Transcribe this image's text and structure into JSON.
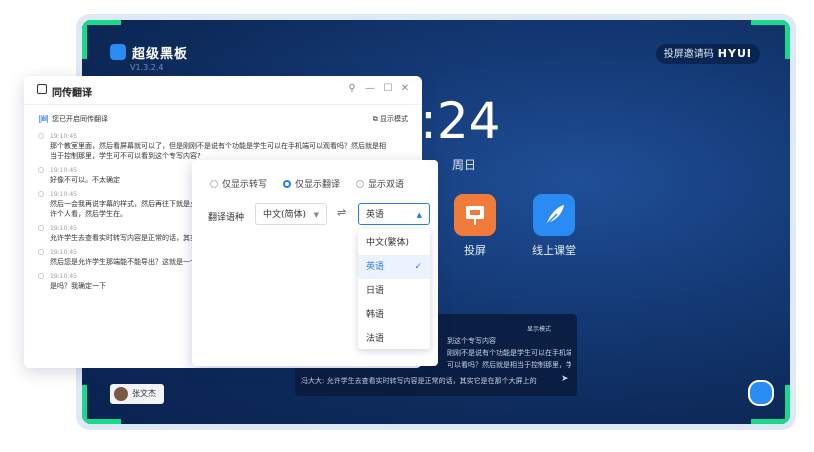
{
  "board": {
    "app_name": "超级黑板",
    "version": "V1.3.2.4",
    "code_label": "投屏邀请码",
    "code": "HYUI",
    "clock": ":24",
    "weekday": "周日",
    "tiles": [
      {
        "label": "投屏",
        "icon": "projector-icon",
        "color": "#f07b3a"
      },
      {
        "label": "线上课堂",
        "icon": "feather-icon",
        "color": "#2a8bf2"
      }
    ],
    "mini": {
      "mode": "显示模式",
      "lines": [
        "到这个专写内容",
        "刚刚不是说有个功能是学生可以在手机端",
        "可以看吗？然后就是相当于控制那里，学生可不可以看到这个专写内容？",
        "冯大大: 允许学生去查看实时转写内容是正常的话，其实它是在那个大屏上的"
      ]
    },
    "user_name": "张文杰",
    "accent": "#19d98b"
  },
  "panel": {
    "title": "同传翻译",
    "status": "您已开启同传翻译",
    "display_mode": "显示模式",
    "messages": [
      {
        "time": "19:10:45",
        "text": "那个教室里面，然后看屏幕就可以了，但是刚刚不是说有个功能是学生可以在手机端可以观看吗？然后就是相当于控制那里，学生可不可以看到这个专写内容?"
      },
      {
        "time": "19:10:45",
        "text": "好像不可以。不太确定"
      },
      {
        "time": "19:10:45",
        "text": "然后一会我再说字幕的样式，然后再往下就是允许个人看，然后学生在。"
      },
      {
        "time": "19:10:45",
        "text": "允许学生去查看实时转写内容是正常的话，其实"
      },
      {
        "time": "19:10:45",
        "text": "然后您是允许学生那端能不能导出？这就是一个"
      },
      {
        "time": "19:10:45",
        "text": "是吗？我确定一下"
      }
    ]
  },
  "dialog": {
    "modes": [
      {
        "label": "仅显示转写",
        "selected": false
      },
      {
        "label": "仅显示翻译",
        "selected": true
      },
      {
        "label": "显示双语",
        "selected": false
      }
    ],
    "lang_label": "翻译语种",
    "source": "中文(简体)",
    "target": "英语",
    "options": [
      {
        "label": "中文(繁体)",
        "selected": false
      },
      {
        "label": "英语",
        "selected": true
      },
      {
        "label": "日语",
        "selected": false
      },
      {
        "label": "韩语",
        "selected": false
      },
      {
        "label": "法语",
        "selected": false
      }
    ]
  }
}
